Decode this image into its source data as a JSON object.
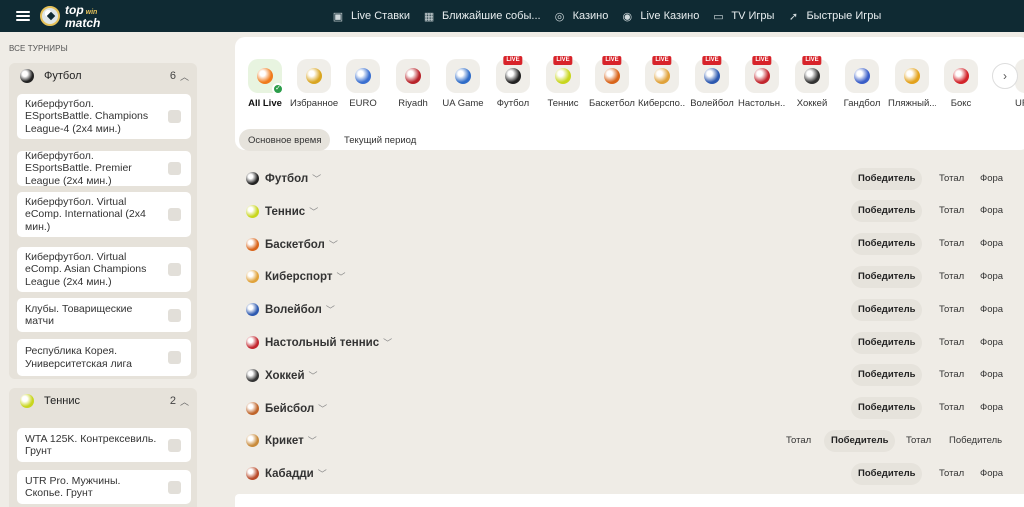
{
  "header": {
    "logo_top": "top",
    "logo_win": "win",
    "logo_bottom": "match",
    "nav": [
      {
        "label": "Live Ставки",
        "icon": "live-screen-icon"
      },
      {
        "label": "Ближайшие собы...",
        "icon": "calendar-icon"
      },
      {
        "label": "Казино",
        "icon": "casino-chip-icon"
      },
      {
        "label": "Live Казино",
        "icon": "live-casino-icon"
      },
      {
        "label": "TV Игры",
        "icon": "tv-icon"
      },
      {
        "label": "Быстрые Игры",
        "icon": "rocket-icon"
      }
    ]
  },
  "sidebar": {
    "heading": "ВСЕ ТУРНИРЫ",
    "sports": [
      {
        "name": "Футбол",
        "count": "6",
        "color": "#222222",
        "leagues": [
          "Киберфутбол. ESportsBattle. Champions League-4 (2x4 мин.)",
          "Киберфутбол. ESportsBattle. Premier League (2x4 мин.)",
          "Киберфутбол. Virtual eComp. International (2x4 мин.)",
          "Киберфутбол. Virtual eComp. Asian Champions League (2x4 мин.)",
          "Клубы. Товарищеские матчи",
          "Республика Корея. Университетская лига"
        ]
      },
      {
        "name": "Теннис",
        "count": "2",
        "color": "#c8d61e",
        "leagues": [
          "WTA 125K. Контрексевиль. Грунт",
          "UTR Pro. Мужчины. Скопье. Грунт"
        ]
      }
    ]
  },
  "categories": {
    "live_badge": "LIVE",
    "items": [
      {
        "label": "All Live",
        "color": "#f07a1a",
        "live": false,
        "active": true
      },
      {
        "label": "Избранное",
        "color": "#d9a520",
        "live": false,
        "active": false
      },
      {
        "label": "EURO",
        "color": "#3a6fd0",
        "live": false,
        "active": false
      },
      {
        "label": "Riyadh",
        "color": "#b8232a",
        "live": false,
        "active": false
      },
      {
        "label": "UA Game",
        "color": "#2f6cc8",
        "live": false,
        "active": false
      },
      {
        "label": "Футбол",
        "color": "#222222",
        "live": true,
        "active": false
      },
      {
        "label": "Теннис",
        "color": "#c8d61e",
        "live": true,
        "active": false
      },
      {
        "label": "Баскетбол",
        "color": "#d9651b",
        "live": true,
        "active": false
      },
      {
        "label": "Киберспо...",
        "color": "#e0a23a",
        "live": true,
        "active": false
      },
      {
        "label": "Волейбол",
        "color": "#2d59b0",
        "live": true,
        "active": false
      },
      {
        "label": "Настольн...",
        "color": "#c2262e",
        "live": true,
        "active": false
      },
      {
        "label": "Хоккей",
        "color": "#333333",
        "live": true,
        "active": false
      },
      {
        "label": "Гандбол",
        "color": "#3a5ec8",
        "live": false,
        "active": false
      },
      {
        "label": "Пляжный...",
        "color": "#e3a21c",
        "live": false,
        "active": false
      },
      {
        "label": "Бокс",
        "color": "#d2232a",
        "live": false,
        "active": false
      },
      {
        "label": "UFC",
        "color": "#555555",
        "live": false,
        "active": false
      }
    ]
  },
  "periods": [
    "Основное время",
    "Текущий период"
  ],
  "sports_rows": [
    {
      "name": "Футбол",
      "color": "#222222",
      "markets": [
        "Победитель",
        "Тотал",
        "Фора"
      ],
      "active": 0
    },
    {
      "name": "Теннис",
      "color": "#c8d61e",
      "markets": [
        "Победитель",
        "Тотал",
        "Фора"
      ],
      "active": 0
    },
    {
      "name": "Баскетбол",
      "color": "#d9651b",
      "markets": [
        "Победитель",
        "Тотал",
        "Фора"
      ],
      "active": 0
    },
    {
      "name": "Киберспорт",
      "color": "#e0a23a",
      "markets": [
        "Победитель",
        "Тотал",
        "Фора"
      ],
      "active": 0
    },
    {
      "name": "Волейбол",
      "color": "#2d59b0",
      "markets": [
        "Победитель",
        "Тотал",
        "Фора"
      ],
      "active": 0
    },
    {
      "name": "Настольный теннис",
      "color": "#c2262e",
      "markets": [
        "Победитель",
        "Тотал",
        "Фора"
      ],
      "active": 0
    },
    {
      "name": "Хоккей",
      "color": "#333333",
      "markets": [
        "Победитель",
        "Тотал",
        "Фора"
      ],
      "active": 0
    },
    {
      "name": "Бейсбол",
      "color": "#c0652a",
      "markets": [
        "Победитель",
        "Тотал",
        "Фора"
      ],
      "active": 0
    },
    {
      "name": "Крикет",
      "color": "#c88a3a",
      "markets": [
        "Тотал",
        "Победитель",
        "Тотал",
        "Победитель"
      ],
      "active": 1
    },
    {
      "name": "Кабадди",
      "color": "#b84a2a",
      "markets": [
        "Победитель",
        "Тотал",
        "Фора"
      ],
      "active": 0
    }
  ]
}
